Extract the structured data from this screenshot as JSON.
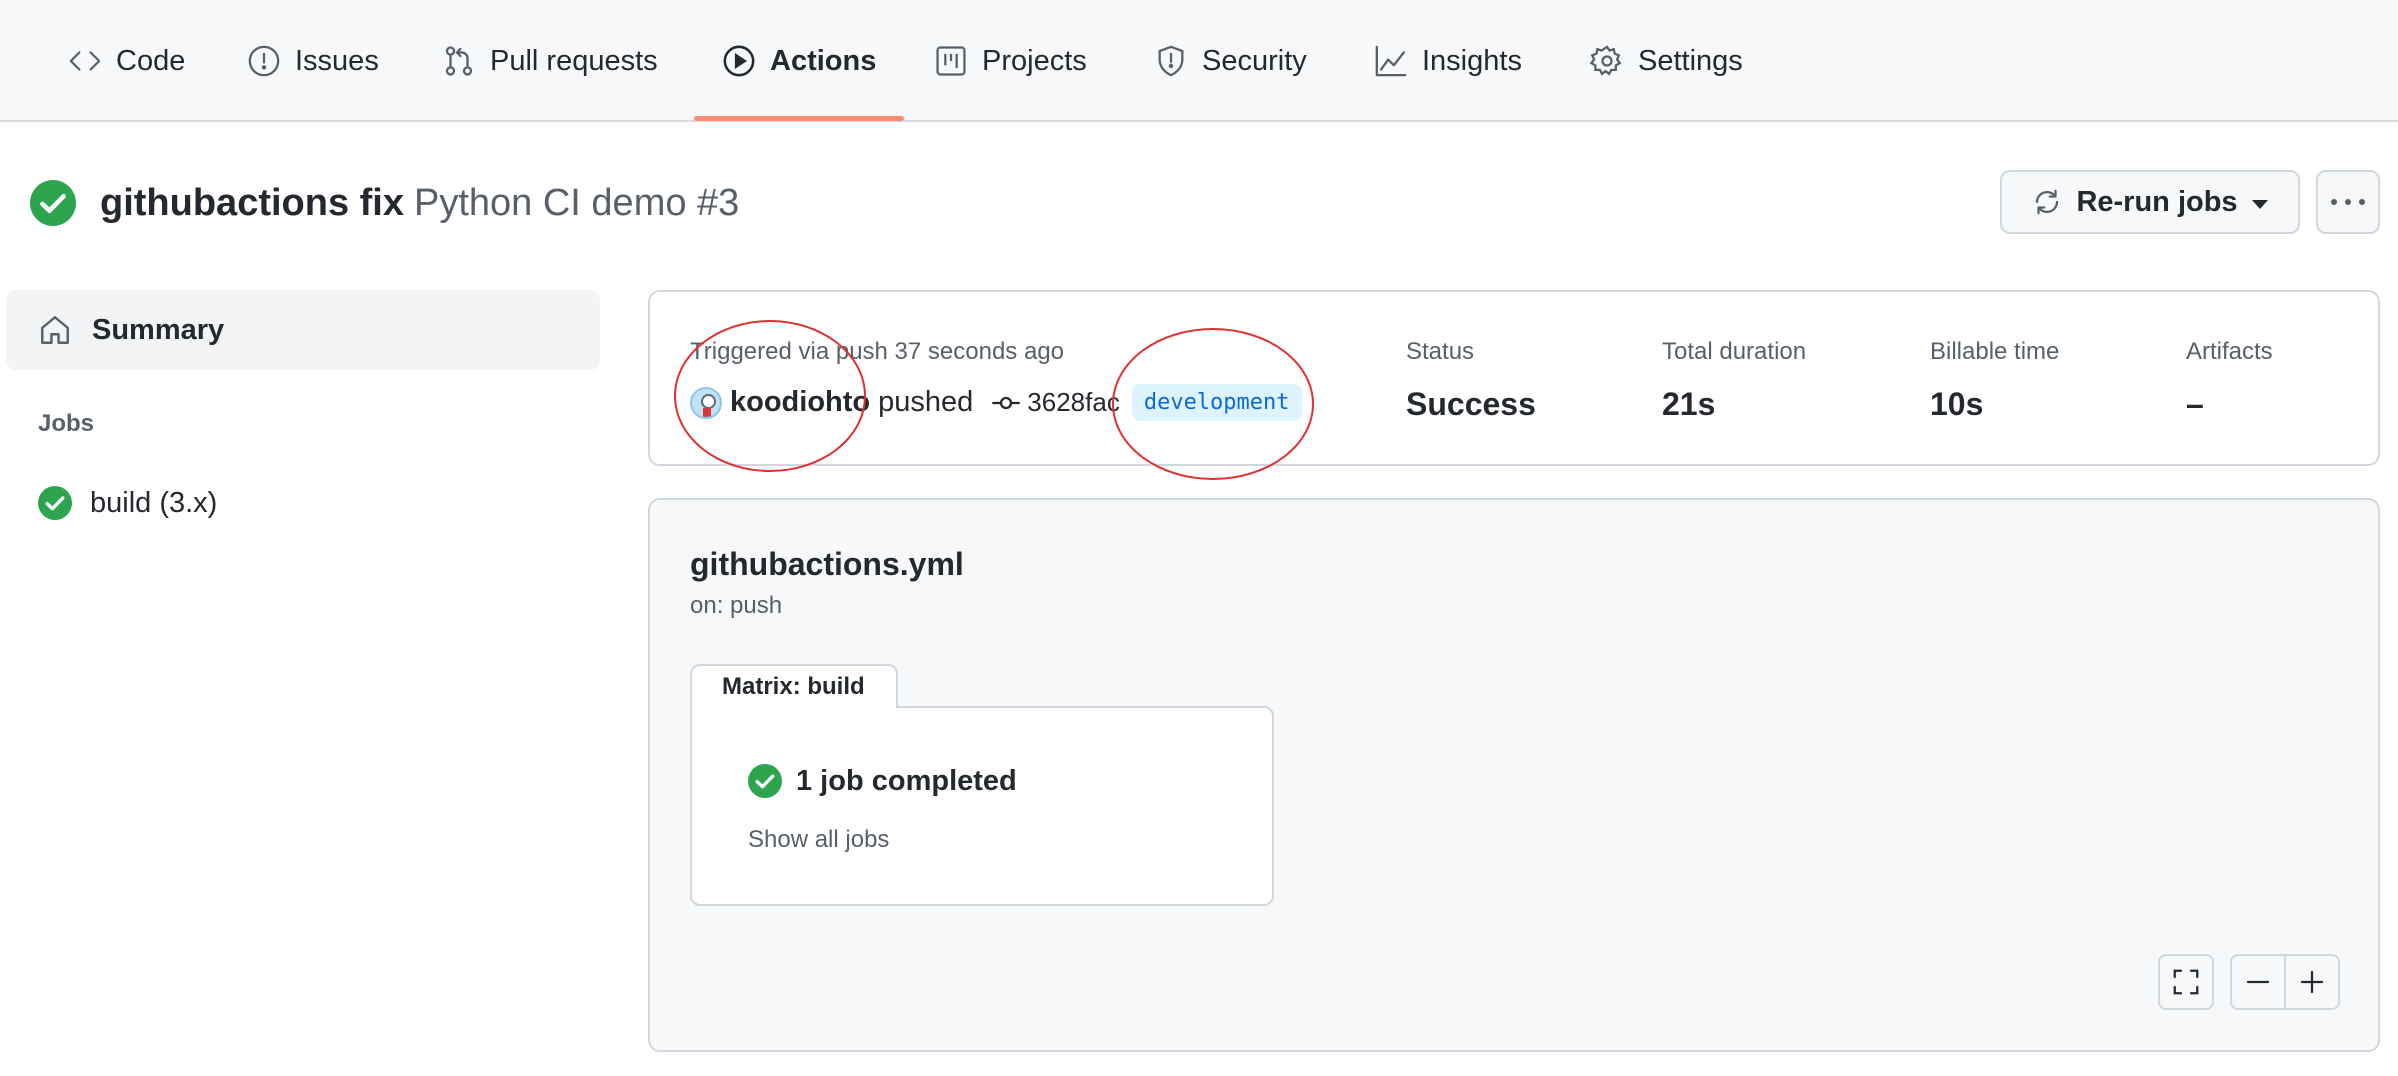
{
  "nav": {
    "tabs": [
      {
        "label": "Code",
        "icon": "code-icon"
      },
      {
        "label": "Issues",
        "icon": "issue-icon"
      },
      {
        "label": "Pull requests",
        "icon": "pull-request-icon"
      },
      {
        "label": "Actions",
        "icon": "play-icon",
        "active": true
      },
      {
        "label": "Projects",
        "icon": "project-icon"
      },
      {
        "label": "Security",
        "icon": "shield-icon"
      },
      {
        "label": "Insights",
        "icon": "graph-icon"
      },
      {
        "label": "Settings",
        "icon": "gear-icon"
      }
    ],
    "active_underline_color": "#fd8c73"
  },
  "run": {
    "title": "githubactions fix",
    "subtitle": "Python CI demo #3",
    "status_icon": "check-circle-icon",
    "rerun_label": "Re-run jobs"
  },
  "sidebar": {
    "summary_label": "Summary",
    "jobs_heading": "Jobs",
    "jobs": [
      {
        "label": "build (3.x)",
        "status": "success"
      }
    ]
  },
  "summary": {
    "trigger_text": "Triggered via push 37 seconds ago",
    "actor": "koodiohto",
    "action": "pushed",
    "commit": "3628fac",
    "branch": "development",
    "status_label": "Status",
    "status_value": "Success",
    "duration_label": "Total duration",
    "duration_value": "21s",
    "billable_label": "Billable time",
    "billable_value": "10s",
    "artifacts_label": "Artifacts",
    "artifacts_value": "–"
  },
  "workflow": {
    "file": "githubactions.yml",
    "trigger": "on: push",
    "matrix_tab": "Matrix: build",
    "matrix_status": "1 job completed",
    "show_all": "Show all jobs"
  },
  "colors": {
    "success": "#2da44e",
    "annotation": "#e03030",
    "branch_bg": "#ddf4ff",
    "branch_fg": "#0969da"
  }
}
